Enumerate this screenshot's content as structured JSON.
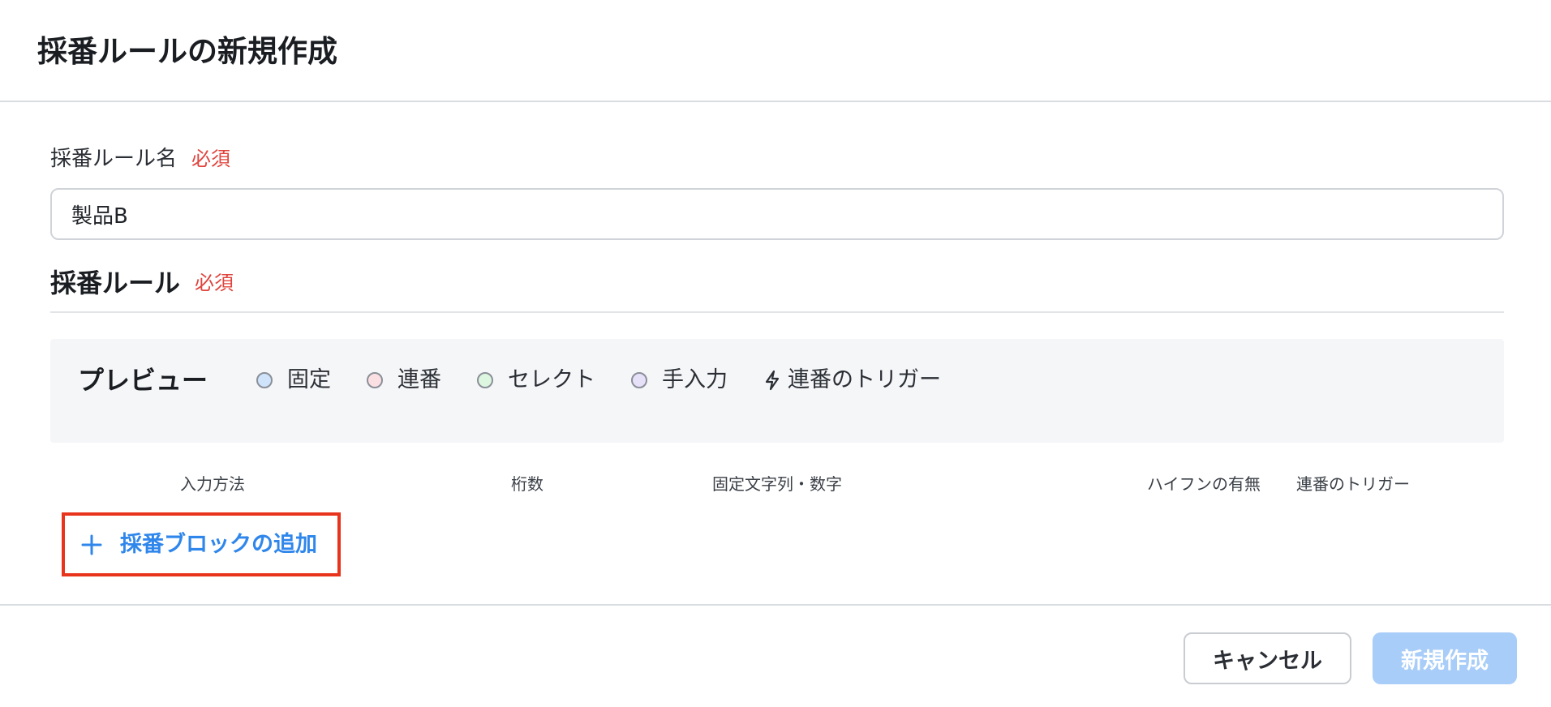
{
  "dialog": {
    "title": "採番ルールの新規作成"
  },
  "form": {
    "rule_name": {
      "label": "採番ルール名",
      "required_label": "必須",
      "value": "製品B"
    },
    "rule": {
      "label": "採番ルール",
      "required_label": "必須"
    }
  },
  "preview": {
    "title": "プレビュー",
    "legend": [
      {
        "label": "固定",
        "color": "#cfe3fb",
        "icon": "circle"
      },
      {
        "label": "連番",
        "color": "#fbe0e3",
        "icon": "circle"
      },
      {
        "label": "セレクト",
        "color": "#ddf6e0",
        "icon": "circle"
      },
      {
        "label": "手入力",
        "color": "#e6e0f8",
        "icon": "circle"
      },
      {
        "label": "連番のトリガー",
        "icon": "lightning-bolt-icon"
      }
    ]
  },
  "table": {
    "columns": [
      "入力方法",
      "桁数",
      "固定文字列・数字",
      "ハイフンの有無",
      "連番のトリガー"
    ]
  },
  "actions": {
    "add_block_label": "採番ブロックの追加",
    "cancel_label": "キャンセル",
    "create_label": "新規作成"
  },
  "colors": {
    "required": "#e0443e",
    "accent": "#2f86eb",
    "highlight_border": "#e8341c",
    "create_disabled": "#a8cdf8"
  }
}
